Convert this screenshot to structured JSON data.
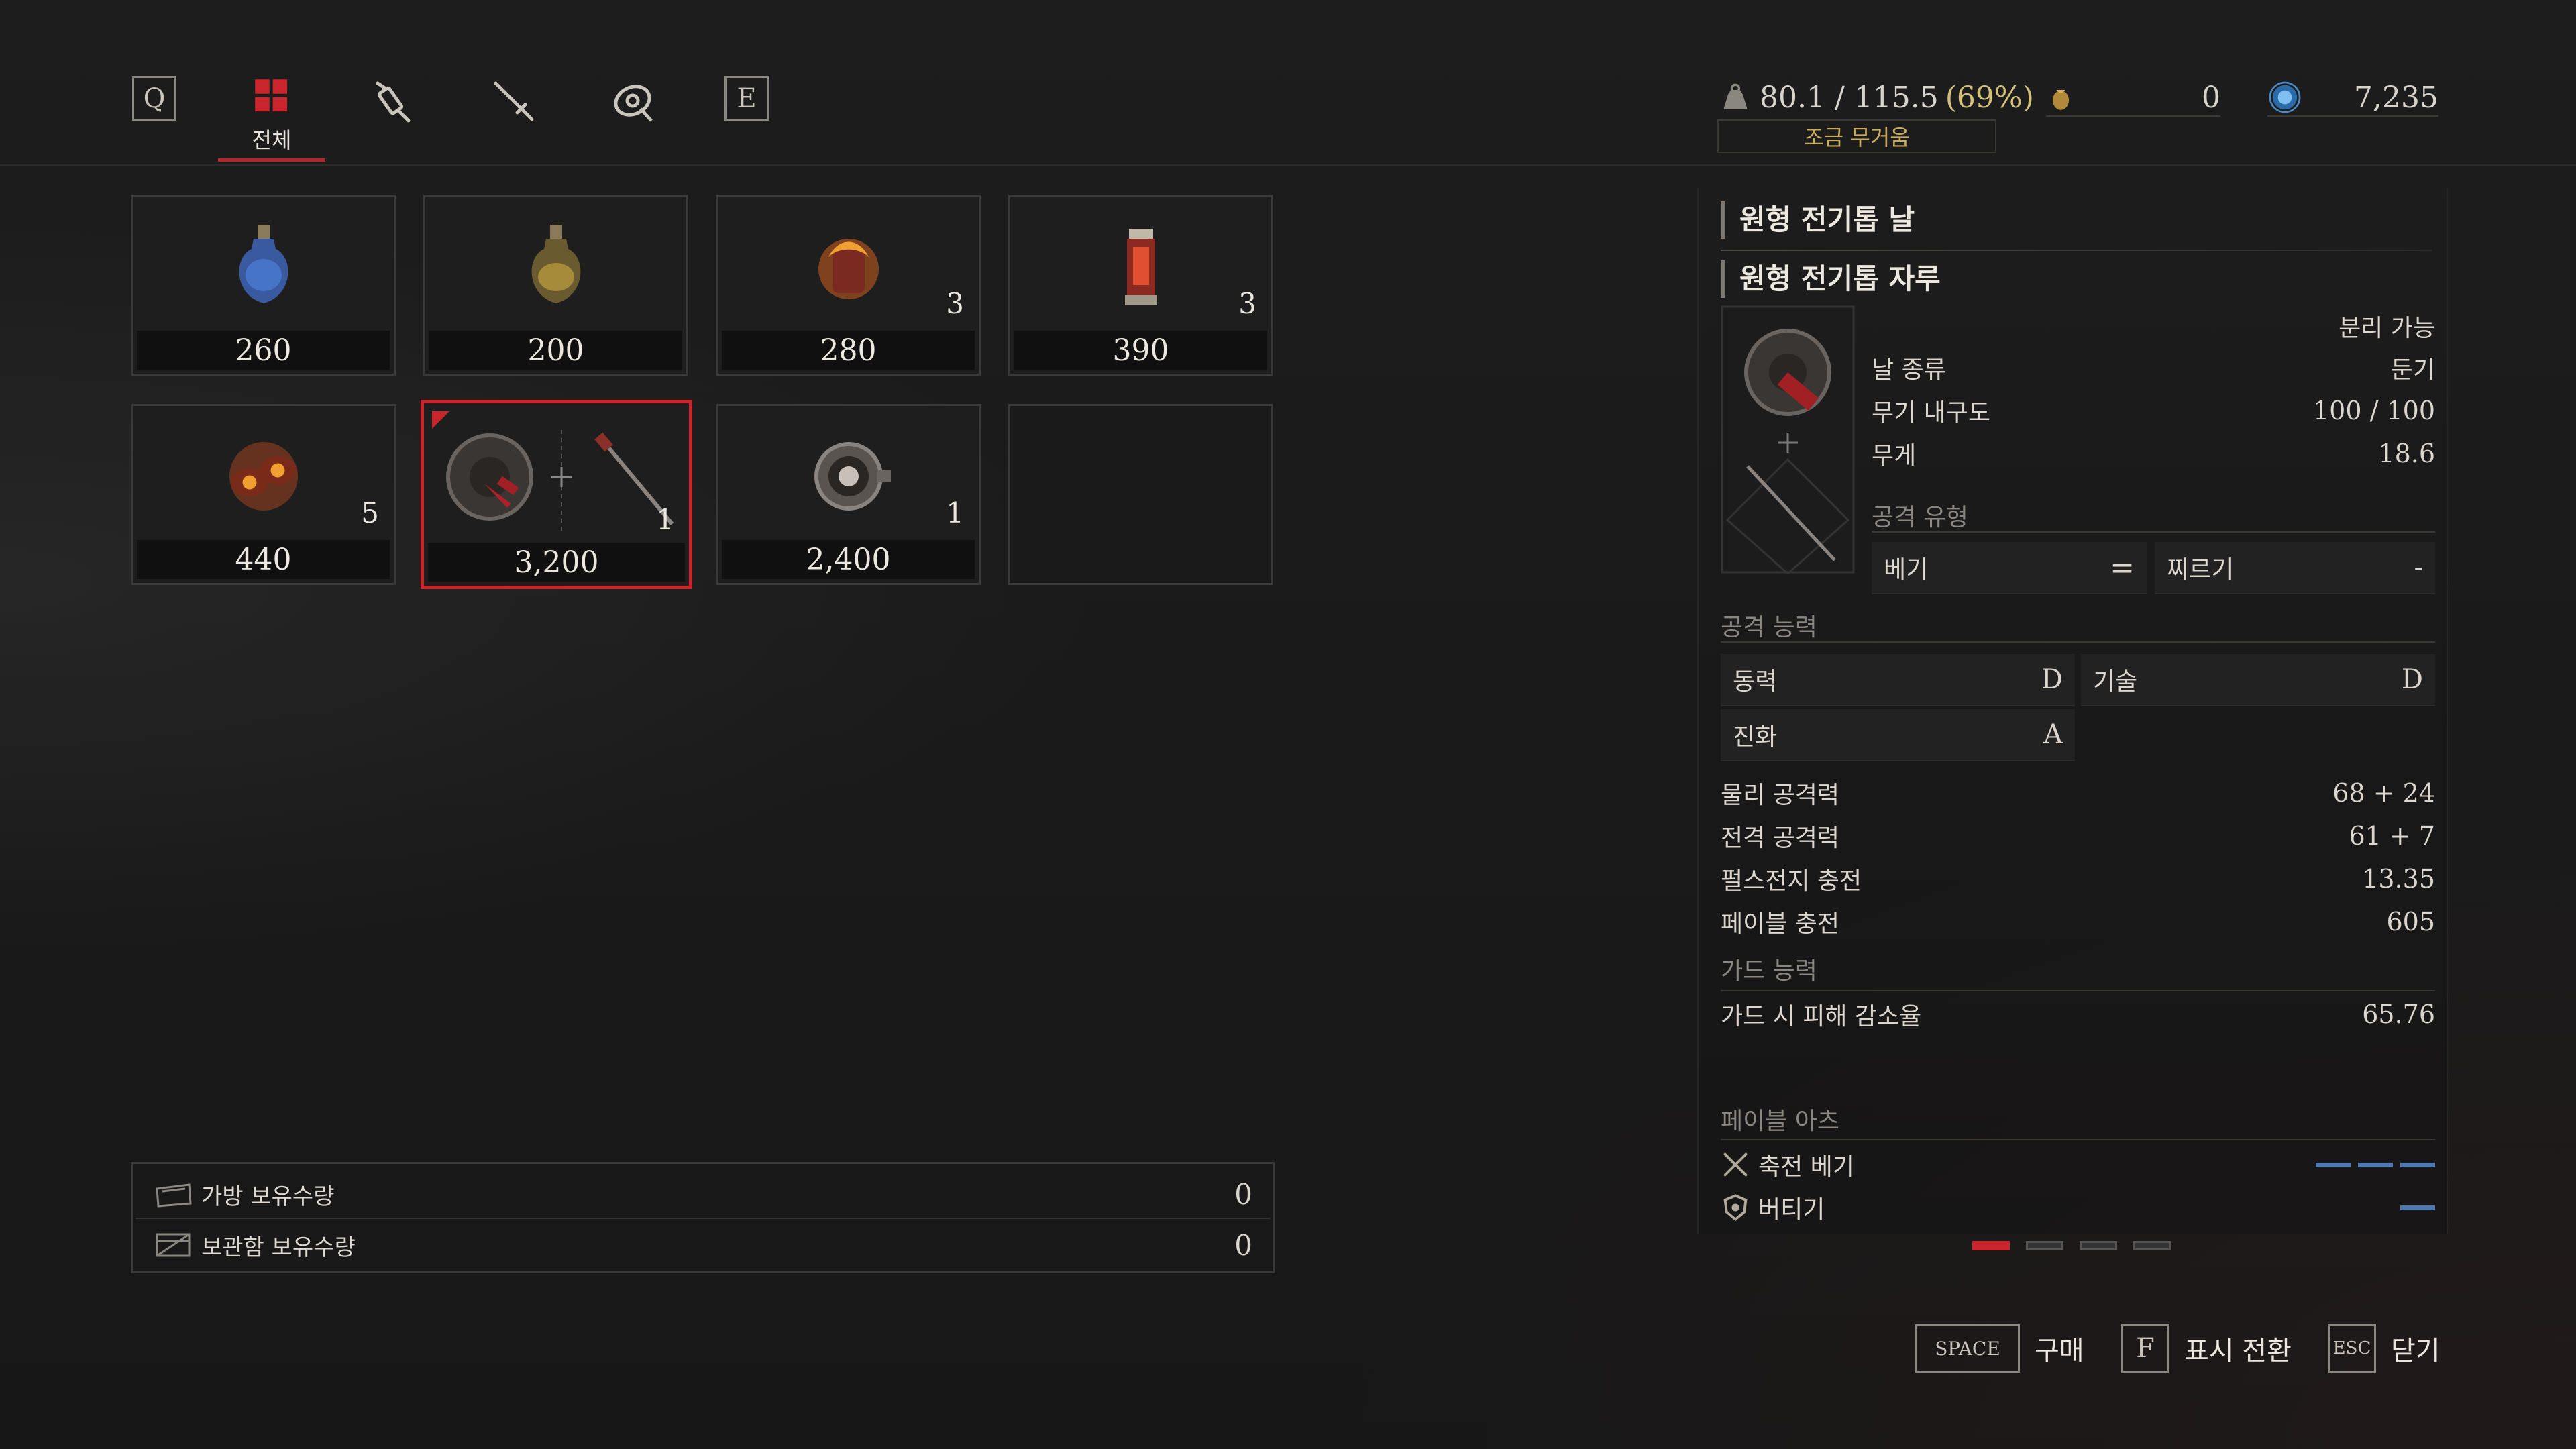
{
  "tabs": {
    "prev_key": "Q",
    "next_key": "E",
    "active_label": "전체",
    "items": [
      {
        "name": "all",
        "icon": "grid-icon"
      },
      {
        "name": "consumables",
        "icon": "syringe-icon"
      },
      {
        "name": "throwables",
        "icon": "dagger-icon"
      },
      {
        "name": "parts",
        "icon": "disc-icon"
      }
    ]
  },
  "header": {
    "weight": "80.1 / 115.5",
    "weight_pct": "(69%)",
    "weight_status": "조금 무거움",
    "currency1": "0",
    "currency2": "7,235"
  },
  "grid": {
    "items": [
      {
        "price": "260",
        "qty": "",
        "icon": "blue-potion-icon"
      },
      {
        "price": "200",
        "qty": "",
        "icon": "yellow-potion-icon"
      },
      {
        "price": "280",
        "qty": "3",
        "icon": "fire-flask-icon"
      },
      {
        "price": "390",
        "qty": "3",
        "icon": "cartridge-icon"
      },
      {
        "price": "440",
        "qty": "5",
        "icon": "fire-grinder-icon"
      },
      {
        "price": "3,200",
        "qty": "1",
        "icon": "circular-saw-weapon-icon"
      },
      {
        "price": "2,400",
        "qty": "1",
        "icon": "ornate-disc-icon"
      },
      {
        "price": "",
        "qty": "",
        "icon": ""
      }
    ]
  },
  "storage": {
    "bag_label": "가방 보유수량",
    "bag_value": "0",
    "box_label": "보관함 보유수량",
    "box_value": "0"
  },
  "detail": {
    "blade_name": "원형 전기톱 날",
    "handle_name": "원형 전기톱 자루",
    "separable": "분리 가능",
    "blade_type_label": "날 종류",
    "blade_type_value": "둔기",
    "durability_label": "무기 내구도",
    "durability_value": "100 / 100",
    "weight_label": "무게",
    "weight_value": "18.6",
    "attack_type_label": "공격 유형",
    "attack_type_1": "베기",
    "attack_type_sep": "=",
    "attack_type_2": "찌르기",
    "attack_type_2_val": "-",
    "ability_label": "공격 능력",
    "motivity_label": "동력",
    "motivity_grade": "D",
    "technique_label": "기술",
    "technique_grade": "D",
    "advance_label": "진화",
    "advance_grade": "A",
    "phys_label": "물리 공격력",
    "phys_value": "68 + 24",
    "elec_label": "전격 공격력",
    "elec_value": "61 + 7",
    "pulse_label": "펄스전지 충전",
    "pulse_value": "13.35",
    "fable_label": "페이블 충전",
    "fable_value": "605",
    "guard_section": "가드 능력",
    "guard_label": "가드 시 피해 감소율",
    "guard_value": "65.76",
    "fable_arts_label": "페이블 아츠",
    "art1": "축전 베기",
    "art2": "버티기"
  },
  "footer": {
    "buy_key": "SPACE",
    "buy_label": "구매",
    "toggle_key": "F",
    "toggle_label": "표시 전환",
    "close_key": "ESC",
    "close_label": "닫기"
  },
  "colors": {
    "accent_red": "#c8262c",
    "fable_blue": "#4d79b0",
    "warning_yellow": "#c9ad5a"
  }
}
